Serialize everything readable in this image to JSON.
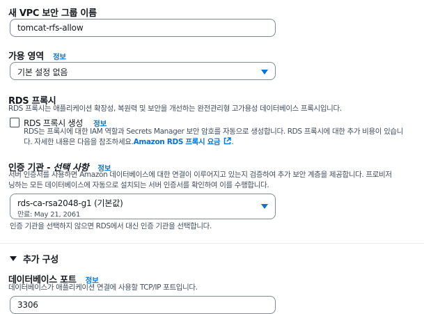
{
  "vpc_sg": {
    "label": "새 VPC 보안 그룹 이름",
    "value": "tomcat-rfs-allow"
  },
  "az": {
    "label": "가용 영역",
    "info": "정보",
    "selected": "기본 설정 없음"
  },
  "rds_proxy": {
    "title": "RDS 프록시",
    "description": "RDS 프록시는 애플리케이션 확장성, 복원력 및 보안을 개선하는 완전관리형 고가용성 데이터베이스 프록시입니다.",
    "checkbox_label": "RDS 프록시 생성",
    "info": "정보",
    "checkbox_desc_line1": "RDS는 프록시에 대한 IAM 역할과 Secrets Manager 보안 암호를 자동으로 생성합니다. RDS 프록시에 대한 추가 비용이 있습니",
    "checkbox_desc_line2": "다. 자세한 내용은 다음을 참조하세요.",
    "link_text": "Amazon RDS 프록시 요금",
    "link_end": "."
  },
  "ca": {
    "label_main": "인증 기관 - ",
    "label_italic": "선택 사항",
    "info": "정보",
    "desc_line1": "서버 인증서를 사용하면 Amazon 데이터베이스에 대한 연결이 이루어지고 있는지 검증하여 추가 보안 계층을 제공합니다. 프로비저",
    "desc_line2": "닝하는 모든 데이터베이스에 자동으로 설치되는 서버 인증서를 확인하여 이를 수행합니다.",
    "selected": "rds-ca-rsa2048-g1 (기본값)",
    "selected_sub": "만료: May 21, 2061",
    "hint": "인증 기관을 선택하지 않으면 RDS에서 대신 인증 기관을 선택합니다."
  },
  "additional": {
    "title": "추가 구성",
    "port_label": "데이터베이스 포트",
    "port_info": "정보",
    "port_desc": "데이터베이스가 애플리케이션 연결에 사용할 TCP/IP 포트입니다.",
    "port_value": "3306"
  },
  "colors": {
    "accent": "#0972d3",
    "text": "#16191f",
    "muted": "#414d5c",
    "border": "#7d8998"
  }
}
